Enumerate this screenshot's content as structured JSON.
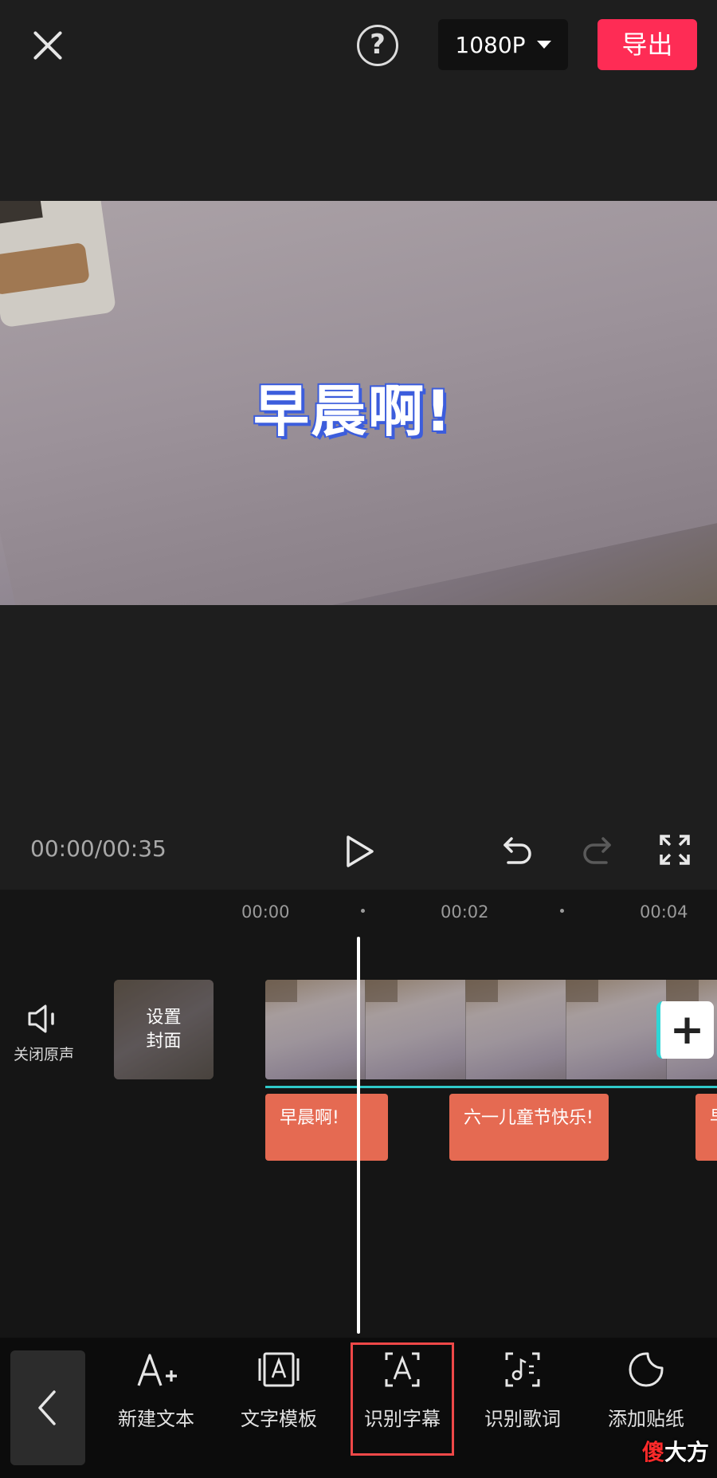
{
  "top_bar": {
    "resolution": "1080P",
    "export_label": "导出"
  },
  "preview": {
    "subtitle_text": "早晨啊!"
  },
  "playback": {
    "time_display": "00:00/00:35"
  },
  "timeline": {
    "ruler_labels": [
      "00:00",
      "00:02",
      "00:04"
    ],
    "mute_label": "关闭原声",
    "cover_label": "设置\n封面",
    "subtitle_clips": [
      "早晨啊!",
      "六一儿童节快乐!",
      "早"
    ]
  },
  "toolbar": {
    "tools": [
      {
        "label": "新建文本",
        "icon": "text-add-icon"
      },
      {
        "label": "文字模板",
        "icon": "text-template-icon"
      },
      {
        "label": "识别字幕",
        "icon": "recognize-subtitle-icon",
        "highlighted": true
      },
      {
        "label": "识别歌词",
        "icon": "recognize-lyrics-icon"
      },
      {
        "label": "添加贴纸",
        "icon": "sticker-icon"
      }
    ]
  },
  "watermark": {
    "prefix": "傻",
    "rest": "大方"
  },
  "colors": {
    "accent_export": "#fe2c55",
    "subtitle_clip": "#e56a52",
    "highlight_border": "#ef4848",
    "timeline_cyan": "#2fc9c9"
  }
}
